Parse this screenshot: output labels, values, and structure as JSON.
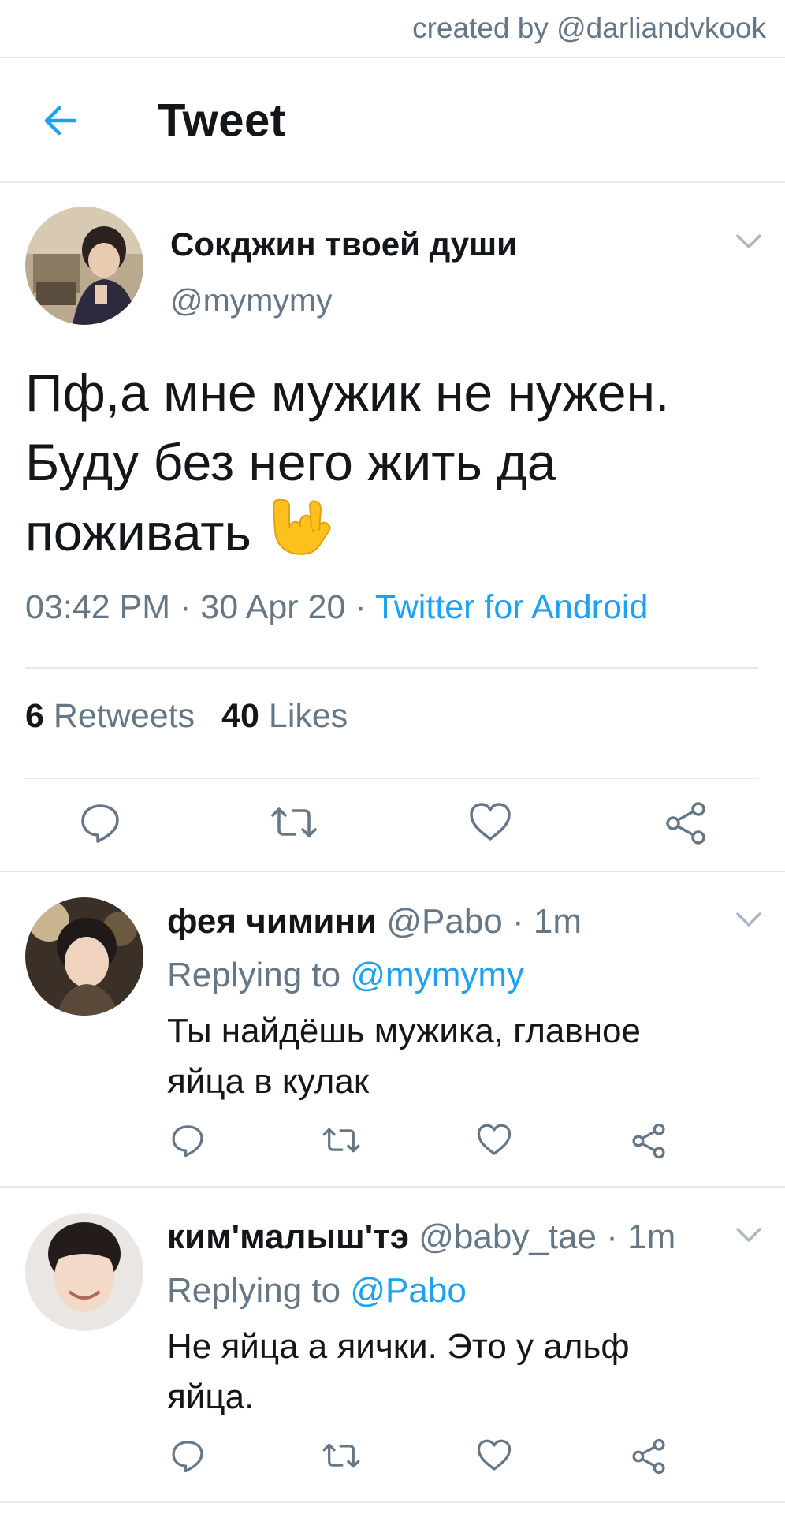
{
  "watermark": "created by @darliandvkook",
  "header": {
    "title": "Tweet"
  },
  "tweet": {
    "author_name": "Сокджин твоей души",
    "author_handle": "@mymymy",
    "text_line1": "Пф,а мне мужик не нужен.",
    "text_line2": "Буду без него жить да",
    "text_line3": "поживать",
    "emoji": "sign-of-the-horns-emoji",
    "time": "03:42 PM",
    "date": "30 Apr 20",
    "source": "Twitter for Android",
    "retweets_count": "6",
    "retweets_label": "Retweets",
    "likes_count": "40",
    "likes_label": "Likes"
  },
  "replies": [
    {
      "name": "фея чимини",
      "handle": "@Pabo",
      "age": "1m",
      "replying_label": "Replying to",
      "replying_to": "@mymymy",
      "text_line1": "Ты найдёшь мужика, главное",
      "text_line2": "яйца в кулак"
    },
    {
      "name": "ким'малыш'тэ",
      "handle": "@baby_tae",
      "age": "1m",
      "replying_label": "Replying to",
      "replying_to": "@Pabo",
      "text_line1": "Не яйца а яички. Это у альф",
      "text_line2": "яйца."
    }
  ],
  "icons": {
    "back": "arrow-left-icon",
    "menu": "chevron-down-icon",
    "reply": "reply-bubble-icon",
    "retweet": "retweet-icon",
    "like": "heart-icon",
    "share": "share-icon"
  },
  "colors": {
    "accent": "#1da1f2",
    "text": "#14171a",
    "secondary": "#657786",
    "divider": "#e1e8ed"
  }
}
